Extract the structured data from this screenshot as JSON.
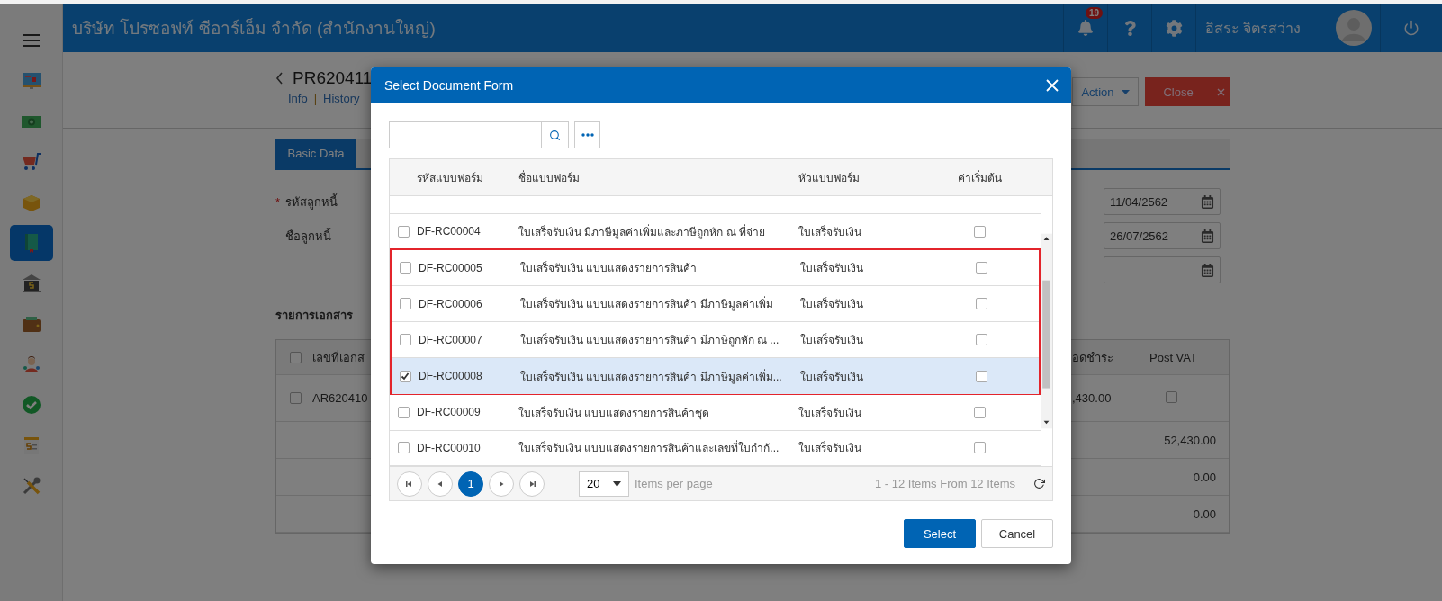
{
  "header": {
    "company": "บริษัท โปรซอฟท์ ซีอาร์เอ็ม จำกัด (สำนักงานใหญ่)",
    "notifications": "19",
    "user": "อิสระ จิตรสว่าง"
  },
  "sidebar": {
    "items": [
      {
        "kind": "monitor",
        "selected": false
      },
      {
        "kind": "banknote",
        "selected": false
      },
      {
        "kind": "cart",
        "selected": false
      },
      {
        "kind": "box",
        "selected": false
      },
      {
        "kind": "book",
        "selected": true
      },
      {
        "kind": "bank",
        "selected": false
      },
      {
        "kind": "wallet",
        "selected": false
      },
      {
        "kind": "people",
        "selected": false
      },
      {
        "kind": "check",
        "selected": false
      },
      {
        "kind": "invoice",
        "selected": false
      },
      {
        "kind": "tools",
        "selected": false
      }
    ]
  },
  "document": {
    "title": "PR620411",
    "links": [
      "Info",
      "History"
    ],
    "link_separator": "|",
    "action_button": "Action",
    "close_button": "Close"
  },
  "required_marker": "*",
  "tabs": [
    {
      "label": "Basic Data",
      "selected": true
    }
  ],
  "fields": [
    {
      "label": "รหัสลูกหนี้",
      "required": true
    },
    {
      "label": "ชื่อลูกหนี้",
      "required": false
    }
  ],
  "date_fields": [
    {
      "kind": "date",
      "value": "11/04/2562"
    },
    {
      "kind": "date",
      "value": "26/07/2562"
    },
    {
      "kind": "date"
    }
  ],
  "documents": {
    "title": "รายการเอกสาร",
    "all_checked": false,
    "columns": [
      "เลขที่เอกส",
      "อดชำระ",
      "Post VAT"
    ],
    "rows": [
      {
        "number": "AR620410",
        "amount": ",430.00",
        "checked": false,
        "post_vat": false
      }
    ],
    "totals": [
      "52,430.00",
      "0.00",
      "0.00"
    ]
  },
  "modal": {
    "title": "Select Document Form",
    "columns": [
      "รหัสแบบฟอร์ม",
      "ชื่อแบบฟอร์ม",
      "หัวแบบฟอร์ม",
      "ค่าเริ่มต้น"
    ],
    "rows": [
      {
        "code": "DF-RC00004",
        "name": "ใบเสร็จรับเงิน มีภาษีมูลค่าเพิ่มและภาษีถูกหัก ณ ที่จ่าย",
        "header": "ใบเสร็จรับเงิน",
        "checked": false,
        "default": false,
        "highlighted": false
      },
      {
        "code": "DF-RC00005",
        "name": "ใบเสร็จรับเงิน แบบแสดงรายการสินค้า",
        "header": "ใบเสร็จรับเงิน",
        "checked": false,
        "default": false,
        "highlighted": true
      },
      {
        "code": "DF-RC00006",
        "name": "ใบเสร็จรับเงิน แบบแสดงรายการสินค้า มีภาษีมูลค่าเพิ่ม",
        "header": "ใบเสร็จรับเงิน",
        "checked": false,
        "default": false,
        "highlighted": true
      },
      {
        "code": "DF-RC00007",
        "name": "ใบเสร็จรับเงิน แบบแสดงรายการสินค้า มีภาษีถูกหัก ณ ...",
        "header": "ใบเสร็จรับเงิน",
        "checked": false,
        "default": false,
        "highlighted": true
      },
      {
        "code": "DF-RC00008",
        "name": "ใบเสร็จรับเงิน แบบแสดงรายการสินค้า มีภาษีมูลค่าเพิ่ม...",
        "header": "ใบเสร็จรับเงิน",
        "checked": true,
        "default": false,
        "highlighted": true
      },
      {
        "code": "DF-RC00009",
        "name": "ใบเสร็จรับเงิน แบบแสดงรายการสินค้าชุด",
        "header": "ใบเสร็จรับเงิน",
        "checked": false,
        "default": false,
        "highlighted": false
      },
      {
        "code": "DF-RC00010",
        "name": "ใบเสร็จรับเงิน แบบแสดงรายการสินค้าและเลขที่ใบกำกั...",
        "header": "ใบเสร็จรับเงิน",
        "checked": false,
        "default": false,
        "highlighted": false
      }
    ],
    "pager": {
      "pages": [
        {
          "label": "1",
          "selected": true
        }
      ],
      "page_size": "20",
      "per_page_label": "Items per page",
      "summary": "1 - 12 Items From 12 Items"
    },
    "buttons": [
      {
        "label": "Select",
        "kind": "primary"
      },
      {
        "label": "Cancel",
        "kind": "secondary"
      }
    ]
  }
}
